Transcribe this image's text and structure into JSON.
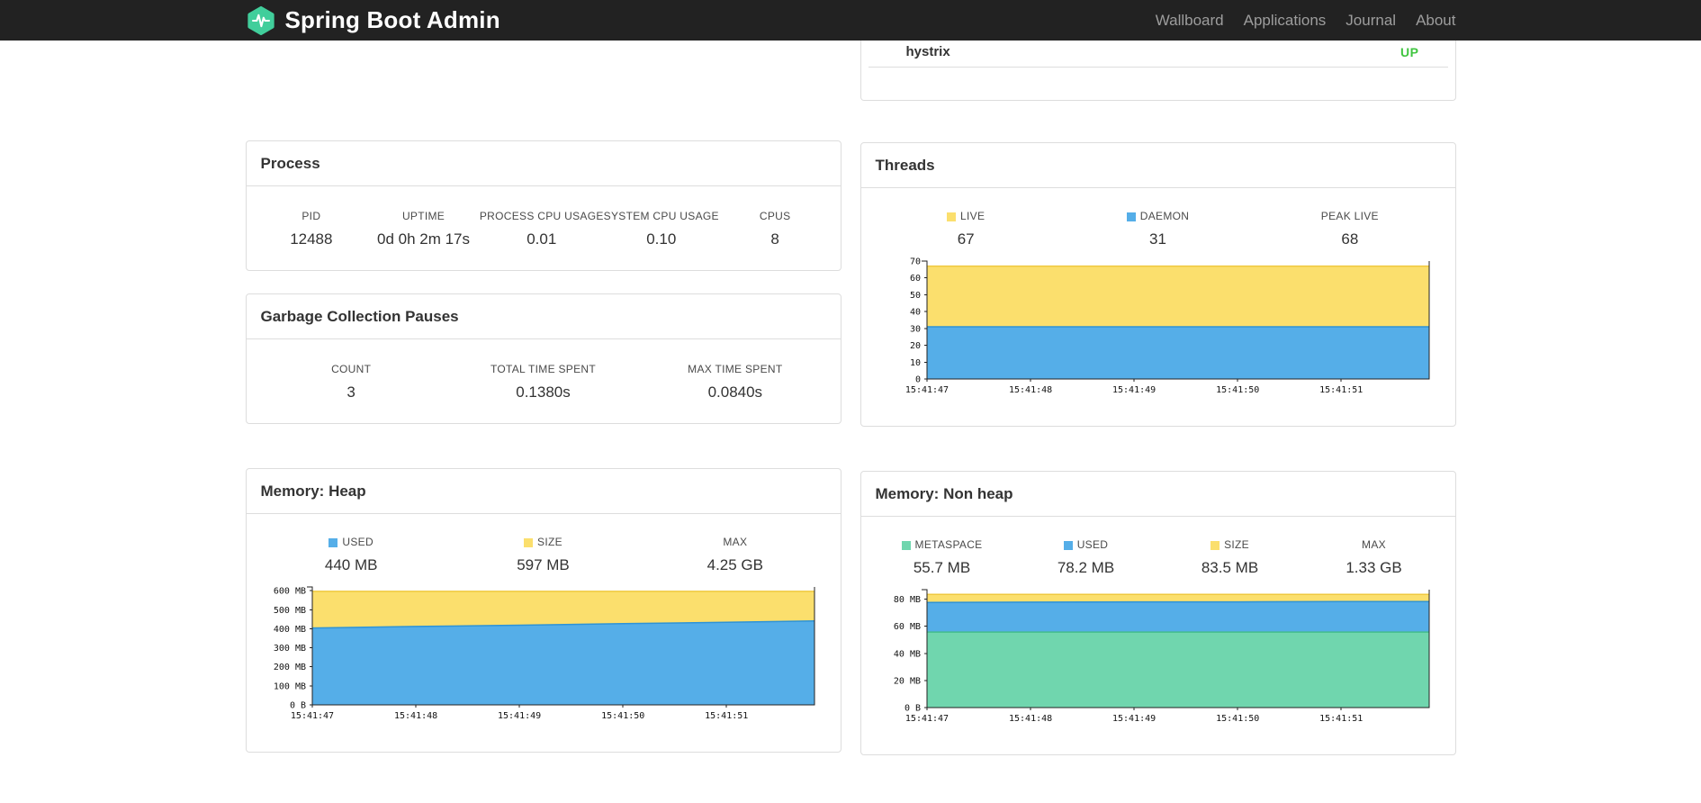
{
  "navbar": {
    "brand": "Spring Boot Admin",
    "links": [
      {
        "label": "Wallboard"
      },
      {
        "label": "Applications"
      },
      {
        "label": "Journal"
      },
      {
        "label": "About"
      }
    ]
  },
  "health": {
    "service": "hystrix",
    "status": "UP"
  },
  "process": {
    "title": "Process",
    "stats": [
      {
        "label": "PID",
        "value": "12488"
      },
      {
        "label": "UPTIME",
        "value": "0d 0h 2m 17s"
      },
      {
        "label": "PROCESS CPU USAGE",
        "value": "0.01"
      },
      {
        "label": "SYSTEM CPU USAGE",
        "value": "0.10"
      },
      {
        "label": "CPUS",
        "value": "8"
      }
    ]
  },
  "gc": {
    "title": "Garbage Collection Pauses",
    "stats": [
      {
        "label": "COUNT",
        "value": "3"
      },
      {
        "label": "TOTAL TIME SPENT",
        "value": "0.1380s"
      },
      {
        "label": "MAX TIME SPENT",
        "value": "0.0840s"
      }
    ]
  },
  "threads": {
    "title": "Threads",
    "legend": [
      {
        "label": "LIVE",
        "value": "67",
        "swatch": "#FBDF6D"
      },
      {
        "label": "DAEMON",
        "value": "31",
        "swatch": "#55AEE8"
      },
      {
        "label": "PEAK LIVE",
        "value": "68"
      }
    ]
  },
  "heap": {
    "title": "Memory: Heap",
    "legend": [
      {
        "label": "USED",
        "value": "440 MB",
        "swatch": "#55AEE8"
      },
      {
        "label": "SIZE",
        "value": "597 MB",
        "swatch": "#FBDF6D"
      },
      {
        "label": "MAX",
        "value": "4.25 GB"
      }
    ]
  },
  "nonheap": {
    "title": "Memory: Non heap",
    "legend": [
      {
        "label": "METASPACE",
        "value": "55.7 MB",
        "swatch": "#70D6AE"
      },
      {
        "label": "USED",
        "value": "78.2 MB",
        "swatch": "#55AEE8"
      },
      {
        "label": "SIZE",
        "value": "83.5 MB",
        "swatch": "#FBDF6D"
      },
      {
        "label": "MAX",
        "value": "1.33 GB"
      }
    ]
  },
  "colors": {
    "navbar_bg": "#222222",
    "brand_green": "#41CE9B",
    "status_up": "#40C540",
    "chart_blue": "#55AEE8",
    "chart_yellow": "#FBDF6D",
    "chart_green": "#70D6AE",
    "panel_border": "#dddddd"
  },
  "chart_data": [
    {
      "id": "threads",
      "type": "area",
      "title": "Threads",
      "xlabel": "",
      "ylabel": "",
      "xlim": [
        0,
        4.85
      ],
      "ylim": [
        0,
        70
      ],
      "grid": false,
      "legend_position": "top",
      "x_seconds": [
        0,
        1,
        2,
        3,
        4,
        4.85
      ],
      "x_ticks": [
        0,
        1,
        2,
        3,
        4
      ],
      "x_tick_labels": [
        "15:41:47",
        "15:41:48",
        "15:41:49",
        "15:41:50",
        "15:41:51"
      ],
      "y_ticks": [
        0,
        10,
        20,
        30,
        40,
        50,
        60,
        70
      ],
      "y_tick_labels": [
        "0",
        "10",
        "20",
        "30",
        "40",
        "50",
        "60",
        "70"
      ],
      "series": [
        {
          "name": "LIVE",
          "current": 67,
          "fill": "#FBDF6D",
          "stroke": "#EFC93F",
          "values": [
            67,
            67,
            67,
            67,
            67,
            67
          ]
        },
        {
          "name": "DAEMON",
          "current": 31,
          "fill": "#55AEE8",
          "stroke": "#2E93D6",
          "values": [
            31,
            31,
            31,
            31,
            31,
            31
          ]
        }
      ],
      "annotations": {
        "peak_live": 68
      }
    },
    {
      "id": "heap",
      "type": "area",
      "title": "Memory: Heap",
      "xlabel": "",
      "ylabel": "",
      "xlim": [
        0,
        4.85
      ],
      "ylim": [
        0,
        620
      ],
      "grid": false,
      "legend_position": "top",
      "x_seconds": [
        0,
        1,
        2,
        3,
        4,
        4.85
      ],
      "x_ticks": [
        0,
        1,
        2,
        3,
        4
      ],
      "x_tick_labels": [
        "15:41:47",
        "15:41:48",
        "15:41:49",
        "15:41:50",
        "15:41:51"
      ],
      "y_ticks": [
        0,
        100,
        200,
        300,
        400,
        500,
        600
      ],
      "y_tick_labels": [
        "0 B",
        "100 MB",
        "200 MB",
        "300 MB",
        "400 MB",
        "500 MB",
        "600 MB"
      ],
      "series": [
        {
          "name": "SIZE",
          "current": 597,
          "unit": "MB",
          "fill": "#FBDF6D",
          "stroke": "#EFC93F",
          "values": [
            597,
            597,
            597,
            597,
            597,
            597
          ]
        },
        {
          "name": "USED",
          "current": 440,
          "unit": "MB",
          "fill": "#55AEE8",
          "stroke": "#2E93D6",
          "values": [
            404,
            412,
            419,
            427,
            434,
            441
          ]
        }
      ],
      "annotations": {
        "max": "4.25 GB"
      }
    },
    {
      "id": "nonheap",
      "type": "area",
      "title": "Memory: Non heap",
      "xlabel": "",
      "ylabel": "",
      "xlim": [
        0,
        4.85
      ],
      "ylim": [
        0,
        87
      ],
      "grid": false,
      "legend_position": "top",
      "x_seconds": [
        0,
        1,
        2,
        3,
        4,
        4.85
      ],
      "x_ticks": [
        0,
        1,
        2,
        3,
        4
      ],
      "x_tick_labels": [
        "15:41:47",
        "15:41:48",
        "15:41:49",
        "15:41:50",
        "15:41:51"
      ],
      "y_ticks": [
        0,
        20,
        40,
        60,
        80
      ],
      "y_tick_labels": [
        "0 B",
        "20 MB",
        "40 MB",
        "60 MB",
        "80 MB"
      ],
      "series": [
        {
          "name": "SIZE",
          "current": 83.5,
          "unit": "MB",
          "fill": "#FBDF6D",
          "stroke": "#EFC93F",
          "values": [
            83.5,
            83.5,
            83.5,
            83.5,
            83.5,
            83.5
          ]
        },
        {
          "name": "USED",
          "current": 78.2,
          "unit": "MB",
          "fill": "#55AEE8",
          "stroke": "#2E93D6",
          "values": [
            77.6,
            77.8,
            78,
            78,
            78.2,
            78.2
          ]
        },
        {
          "name": "METASPACE",
          "current": 55.7,
          "unit": "MB",
          "fill": "#70D6AE",
          "stroke": "#44BC8C",
          "values": [
            55.7,
            55.7,
            55.7,
            55.7,
            55.7,
            55.7
          ]
        }
      ],
      "annotations": {
        "max": "1.33 GB"
      }
    }
  ]
}
